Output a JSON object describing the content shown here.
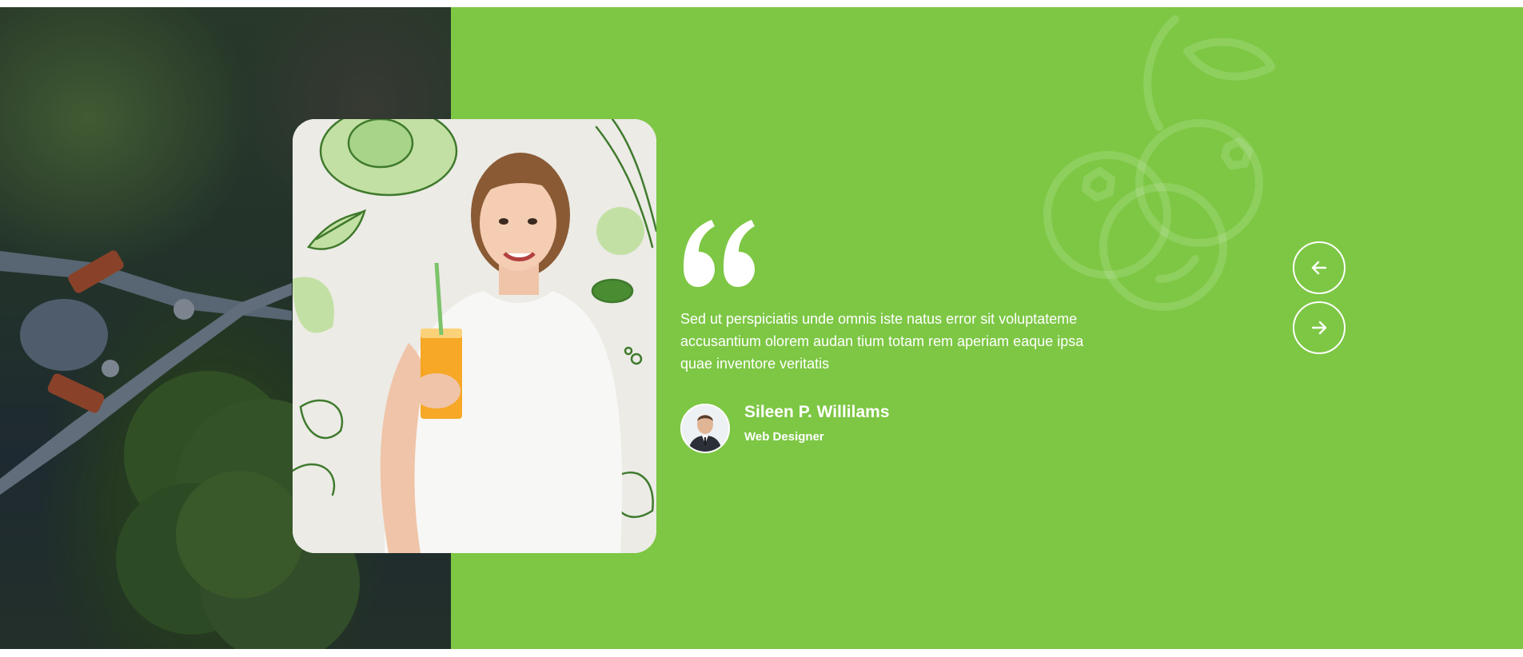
{
  "colors": {
    "accent_green": "#7dc744",
    "text": "#ffffff"
  },
  "testimonial": {
    "quote_icon": "quote-open-icon",
    "text": "Sed ut perspiciatis unde omnis iste natus error sit voluptateme accusantium olorem audan tium totam rem aperiam eaque ipsa quae inventore veritatis",
    "author": {
      "name": "Sileen P. Willilams",
      "role": "Web Designer"
    }
  },
  "navigation": {
    "prev_icon": "arrow-left-icon",
    "next_icon": "arrow-right-icon"
  },
  "decoration": {
    "background_icon": "fruit-outline-icon"
  }
}
